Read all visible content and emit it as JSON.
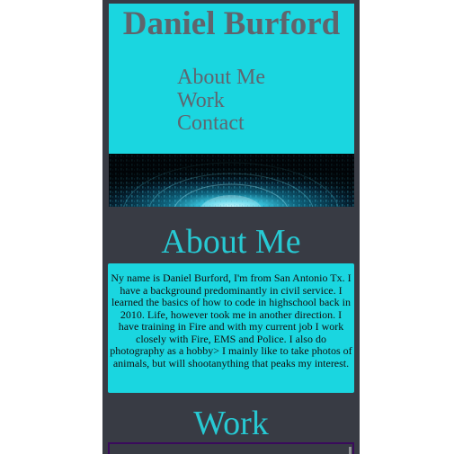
{
  "header": {
    "title": "Daniel Burford",
    "nav": [
      "About Me",
      "Work",
      "Contact"
    ]
  },
  "banner": {
    "icon": "binary-tunnel-image"
  },
  "about": {
    "heading": "About Me",
    "body": "Ny name is Daniel Burford, I'm from San Antonio Tx. I have a background predominantly in civil service. I learned the basics of how to code in highschool back in 2010. Life, however took me in another direction. I have training in Fire and with my current job I work closely with Fire, EMS and Police. I also do photography as a hobby> I mainly like to take photos of animals, but will shootanything that peaks my interest."
  },
  "work": {
    "heading": "Work"
  },
  "colors": {
    "accent": "#1ad6e0",
    "page_bg": "#383b44",
    "heading_text": "#27c9d3",
    "title_text": "#60646c"
  }
}
